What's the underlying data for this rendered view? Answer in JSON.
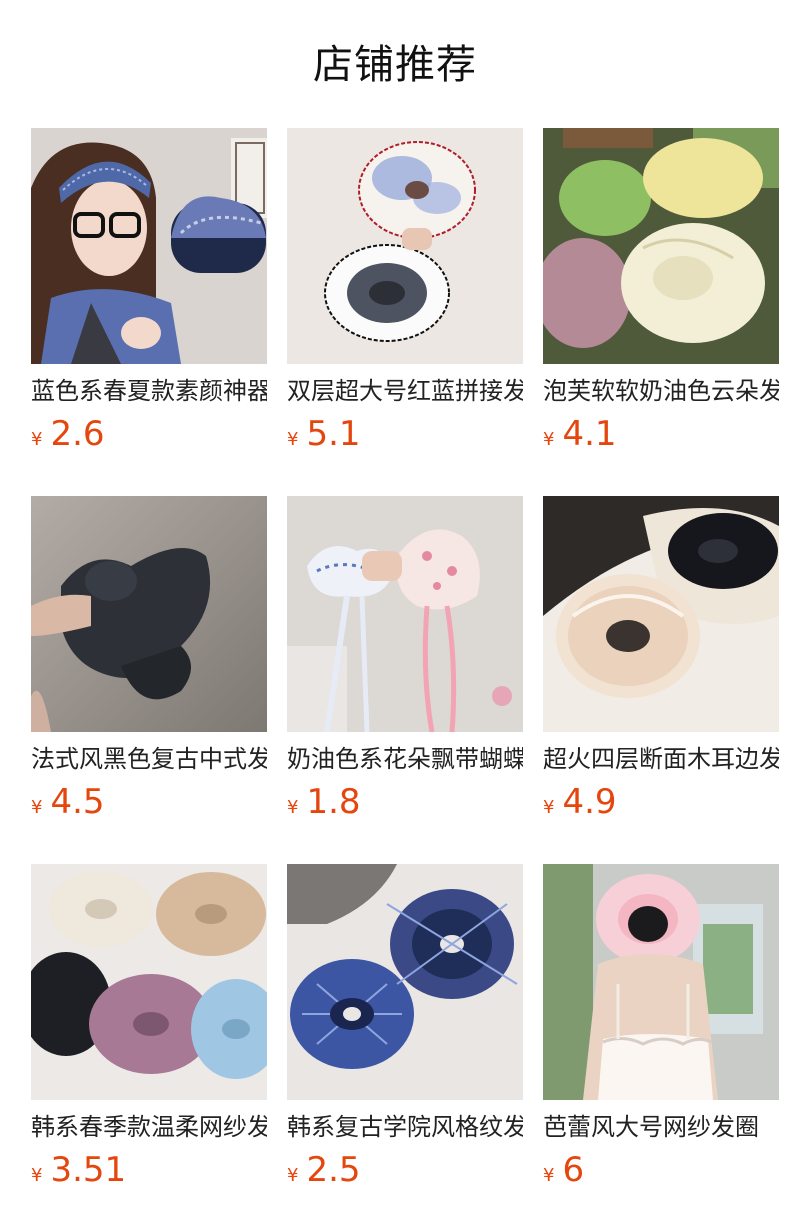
{
  "section": {
    "title": "店铺推荐"
  },
  "products": [
    {
      "name": "蓝色系春夏款素颜神器发箍",
      "currency": "¥",
      "price": "2.6",
      "image": "woman-with-plaid-headband-photo"
    },
    {
      "name": "双层超大号红蓝拼接发圈",
      "currency": "¥",
      "price": "5.1",
      "image": "two-layer-scrunchies-photo"
    },
    {
      "name": "泡芙软软奶油色云朵发圈",
      "currency": "¥",
      "price": "4.1",
      "image": "cream-cloud-scrunchies-photo"
    },
    {
      "name": "法式风黑色复古中式发圈",
      "currency": "¥",
      "price": "4.5",
      "image": "black-bow-scrunchie-photo"
    },
    {
      "name": "奶油色系花朵飘带蝴蝶结发圈",
      "currency": "¥",
      "price": "1.8",
      "image": "floral-ribbon-scrunchies-photo"
    },
    {
      "name": "超火四层断面木耳边发圈",
      "currency": "¥",
      "price": "4.9",
      "image": "satin-ruffle-scrunchies-photo"
    },
    {
      "name": "韩系春季款温柔网纱发圈",
      "currency": "¥",
      "price": "3.51",
      "image": "organza-scrunchies-photo"
    },
    {
      "name": "韩系复古学院风格纹发圈",
      "currency": "¥",
      "price": "2.5",
      "image": "navy-plaid-scrunchies-photo"
    },
    {
      "name": "芭蕾风大号网纱发圈",
      "currency": "¥",
      "price": "6",
      "image": "ballet-tulle-scrunchie-photo"
    }
  ]
}
